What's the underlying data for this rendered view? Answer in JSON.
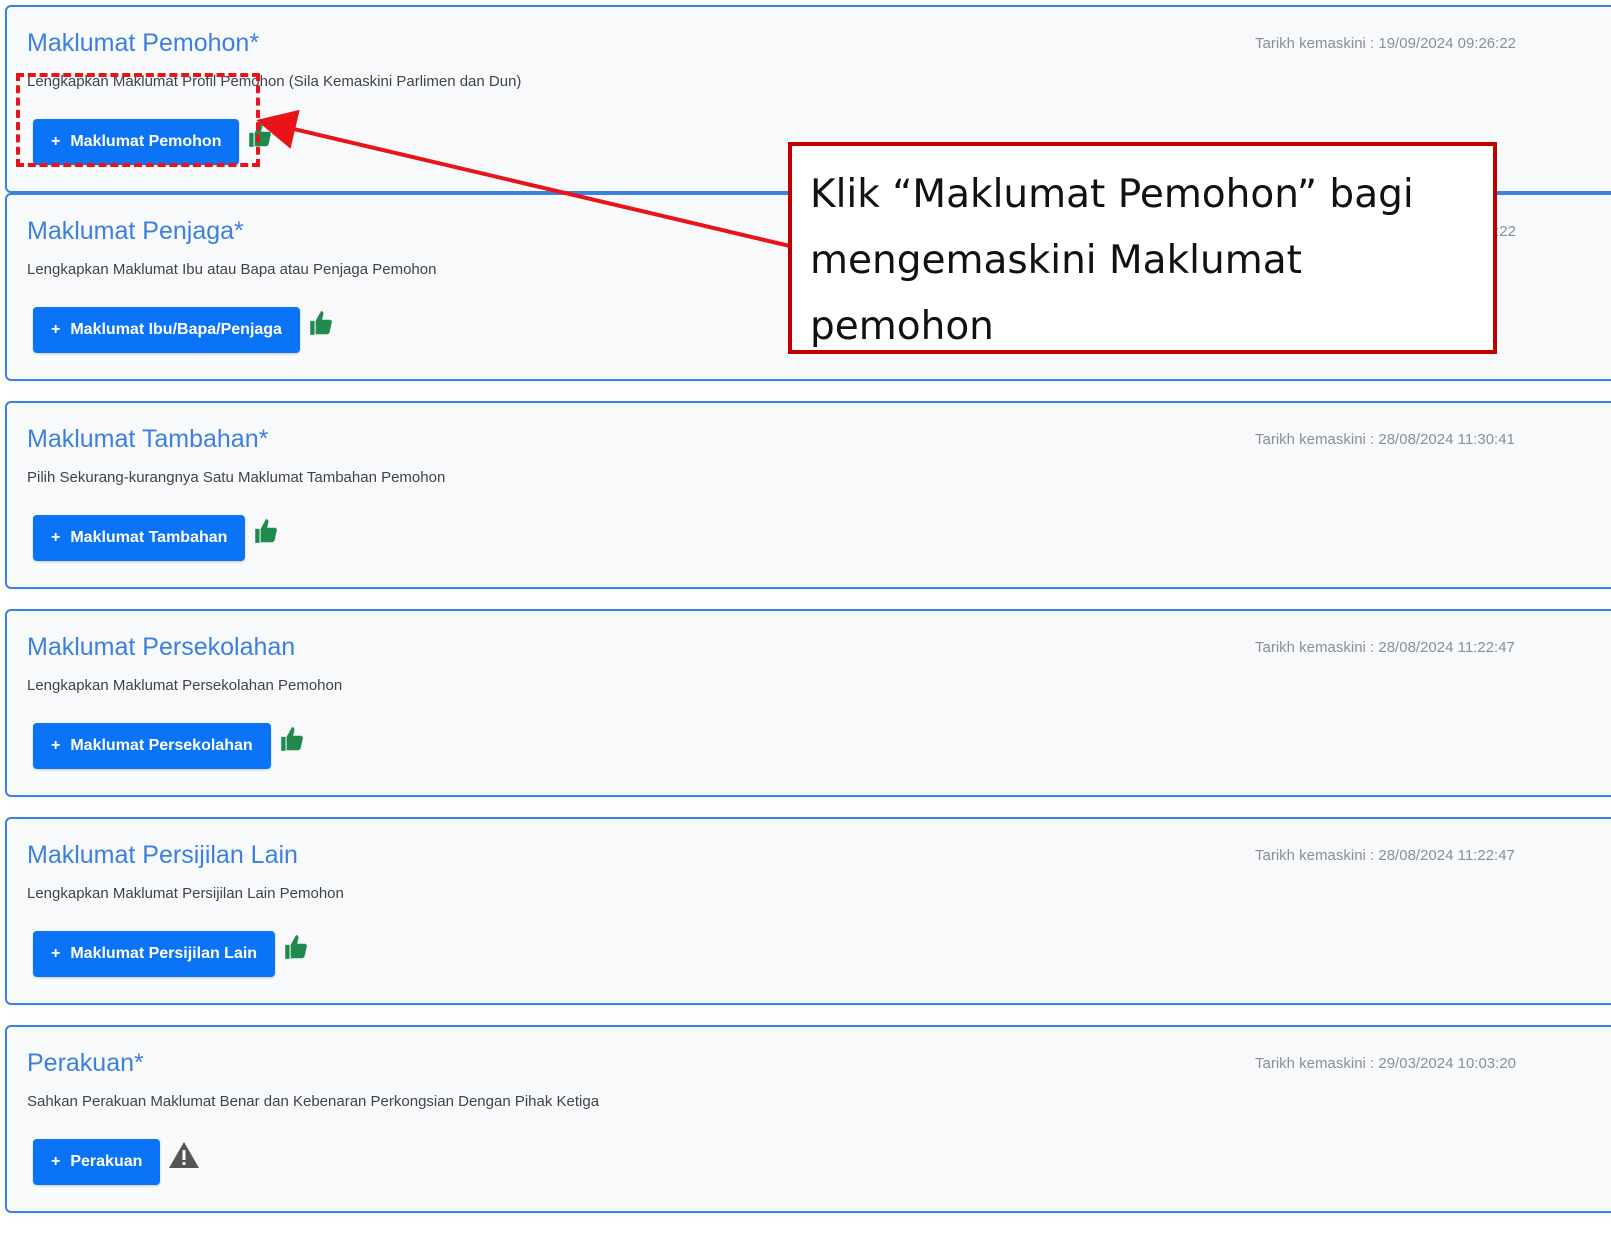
{
  "sections": [
    {
      "title": "Maklumat Pemohon*",
      "updated": "Tarikh kemaskini : 19/09/2024 09:26:22",
      "description": "Lengkapkan Maklumat Profil Pemohon (Sila Kemaskini Parlimen dan Dun)",
      "button_label": "Maklumat Pemohon",
      "status_icon": "thumbs-up-icon"
    },
    {
      "title": "Maklumat Penjaga*",
      "updated": "Tarikh kemaskini : 19/09/2024 09:26:22",
      "description": "Lengkapkan Maklumat Ibu atau Bapa atau Penjaga Pemohon",
      "button_label": "Maklumat Ibu/Bapa/Penjaga",
      "status_icon": "thumbs-up-icon"
    },
    {
      "title": "Maklumat Tambahan*",
      "updated": "Tarikh kemaskini : 28/08/2024 11:30:41",
      "description": "Pilih Sekurang-kurangnya Satu Maklumat Tambahan Pemohon",
      "button_label": "Maklumat Tambahan",
      "status_icon": "thumbs-up-icon"
    },
    {
      "title": "Maklumat Persekolahan",
      "updated": "Tarikh kemaskini : 28/08/2024 11:22:47",
      "description": "Lengkapkan Maklumat Persekolahan Pemohon",
      "button_label": "Maklumat Persekolahan",
      "status_icon": "thumbs-up-icon"
    },
    {
      "title": "Maklumat Persijilan Lain",
      "updated": "Tarikh kemaskini : 28/08/2024 11:22:47",
      "description": "Lengkapkan Maklumat Persijilan Lain Pemohon",
      "button_label": "Maklumat Persijilan Lain",
      "status_icon": "thumbs-up-icon"
    },
    {
      "title": "Perakuan*",
      "updated": "Tarikh kemaskini : 29/03/2024 10:03:20",
      "description": "Sahkan Perakuan Maklumat Benar dan Kebenaran Perkongsian Dengan Pihak Ketiga",
      "button_label": "Perakuan",
      "status_icon": "warning-icon"
    }
  ],
  "button_prefix": "+",
  "annotation": {
    "callout_text": "Klik  “Maklumat Pemohon” bagi mengemaskini  Maklumat pemohon"
  },
  "colors": {
    "primary": "#0b73f5",
    "title": "#3d7fdc",
    "card_border": "#3b82e0",
    "success": "#1f8a4c",
    "warning": "#555555",
    "annotation_red": "#e8141a"
  }
}
